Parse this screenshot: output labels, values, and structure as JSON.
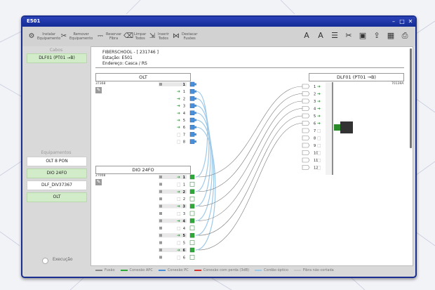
{
  "window": {
    "title": "E501"
  },
  "toolbar": {
    "buttons": [
      {
        "icon": "install-equipment-icon",
        "label1": "Instalar",
        "label2": "Equipamento"
      },
      {
        "icon": "remove-equipment-icon",
        "label1": "Remover",
        "label2": "Equipamento"
      },
      {
        "icon": "reserve-fiber-icon",
        "label1": "Reservar",
        "label2": "Fibra"
      },
      {
        "icon": "clean-all-icon",
        "label1": "Limpar",
        "label2": "Todos"
      },
      {
        "icon": "insert-all-icon",
        "label1": "Inserir",
        "label2": "Todos"
      },
      {
        "icon": "highlight-fusions-icon",
        "label1": "Destacar",
        "label2": "Fusões"
      }
    ],
    "right_icons": [
      "text-a-icon",
      "text-b-icon",
      "list-icon",
      "cut-icon",
      "save-icon",
      "export-icon",
      "grid-icon",
      "print-icon"
    ]
  },
  "sidebar": {
    "cables_header": "Cabos",
    "cables": [
      "DLF01 (PT01 →B)"
    ],
    "equipment_header": "Equipamentos",
    "equipment": [
      {
        "label": "OLT 8 PON",
        "style": "white"
      },
      {
        "label": "DIO 24FO",
        "style": "green"
      },
      {
        "label": "DLF_DIV37367",
        "style": "white"
      },
      {
        "label": "OLT",
        "style": "green"
      }
    ],
    "execution_label": "Execução"
  },
  "station": {
    "line1": "FIBERSCHOOL - [ 231746 ]",
    "line2": "Estação: E501",
    "line3": "Endereço: Casca / RS"
  },
  "olt": {
    "title": "OLT",
    "id": "37368",
    "ports": [
      1,
      1,
      2,
      3,
      4,
      5,
      6,
      7,
      8
    ]
  },
  "dio": {
    "title": "DIO 24FO",
    "id": "27008",
    "ports": [
      1,
      1,
      2,
      2,
      3,
      3,
      4,
      4,
      5,
      5,
      6,
      6
    ]
  },
  "cable": {
    "title": "DLF01 (PT01 →B)",
    "id": "70139A",
    "fibers": [
      1,
      2,
      3,
      4,
      5,
      6,
      7,
      8,
      9,
      10,
      11,
      12
    ]
  },
  "legend": [
    {
      "label": "Fusão",
      "color": "#8a8a8a"
    },
    {
      "label": "Conexão APC",
      "color": "#2fa83a"
    },
    {
      "label": "Conexão PC",
      "color": "#4a90d9"
    },
    {
      "label": "Conexão com perda (3dB)",
      "color": "#d9342b"
    },
    {
      "label": "Cordão óptico",
      "color": "#9ec9e8"
    },
    {
      "label": "Fibra não cortada",
      "color": "#c8c8c8"
    }
  ],
  "colors": {
    "titlebar": "#1a2f8f",
    "apc_green": "#2fa83a",
    "pc_blue": "#4a90d9"
  }
}
